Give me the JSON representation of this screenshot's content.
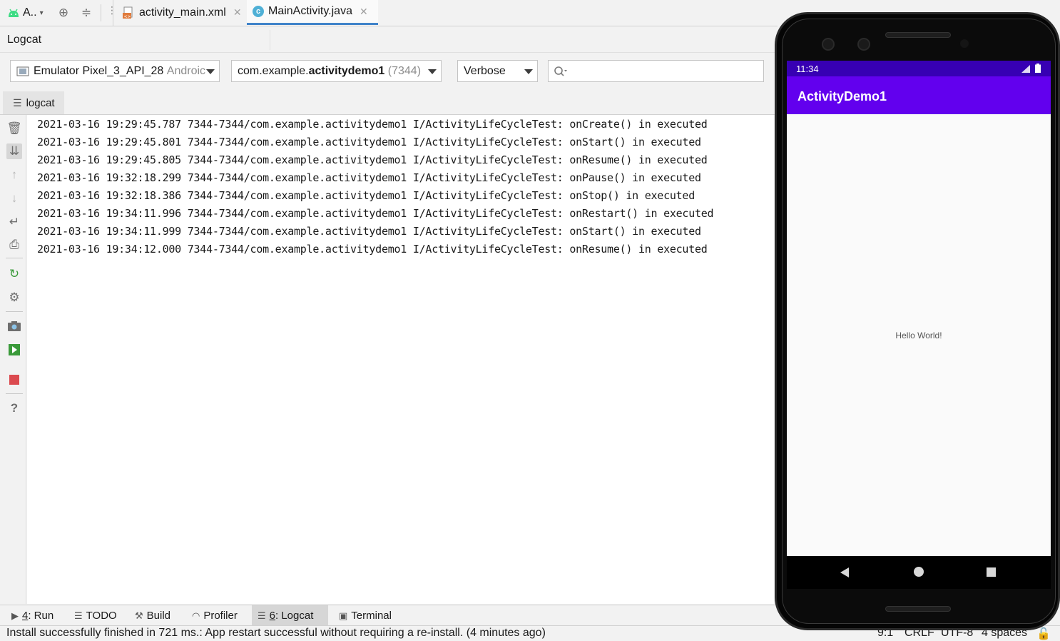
{
  "toolbar": {
    "project_label": "A..",
    "tabs": [
      {
        "label": "activity_main.xml",
        "active": false
      },
      {
        "label": "MainActivity.java",
        "active": true
      }
    ]
  },
  "logcat": {
    "title": "Logcat",
    "device_combo": {
      "name": "Emulator Pixel_3_API_28",
      "suffix": "Androic"
    },
    "process_combo": {
      "prefix": "com.example.",
      "bold": "activitydemo1",
      "pid": "(7344)"
    },
    "level_combo": "Verbose",
    "search_placeholder": "",
    "subtab": "logcat",
    "lines": [
      "2021-03-16 19:29:45.787 7344-7344/com.example.activitydemo1 I/ActivityLifeCycleTest: onCreate() in executed",
      "2021-03-16 19:29:45.801 7344-7344/com.example.activitydemo1 I/ActivityLifeCycleTest: onStart() in executed",
      "2021-03-16 19:29:45.805 7344-7344/com.example.activitydemo1 I/ActivityLifeCycleTest: onResume() in executed",
      "2021-03-16 19:32:18.299 7344-7344/com.example.activitydemo1 I/ActivityLifeCycleTest: onPause() in executed",
      "2021-03-16 19:32:18.386 7344-7344/com.example.activitydemo1 I/ActivityLifeCycleTest: onStop() in executed",
      "2021-03-16 19:34:11.996 7344-7344/com.example.activitydemo1 I/ActivityLifeCycleTest: onRestart() in executed",
      "2021-03-16 19:34:11.999 7344-7344/com.example.activitydemo1 I/ActivityLifeCycleTest: onStart() in executed",
      "2021-03-16 19:34:12.000 7344-7344/com.example.activitydemo1 I/ActivityLifeCycleTest: onResume() in executed"
    ]
  },
  "bottom_tools": {
    "run": {
      "key": "4",
      "label": ": Run"
    },
    "todo": "TODO",
    "build": "Build",
    "profiler": "Profiler",
    "logcat": {
      "key": "6",
      "label": ": Logcat"
    },
    "terminal": "Terminal"
  },
  "status": {
    "message": "Install successfully finished in 721 ms.: App restart successful without requiring a re-install. (4 minutes ago)",
    "position": "9:1",
    "line_sep": "CRLF",
    "encoding": "UTF-8",
    "indent": "4 spaces"
  },
  "emulator": {
    "time": "11:34",
    "app_title": "ActivityDemo1",
    "body_text": "Hello World!",
    "colors": {
      "status_bar": "#3700b3",
      "app_bar": "#6200ee"
    }
  }
}
